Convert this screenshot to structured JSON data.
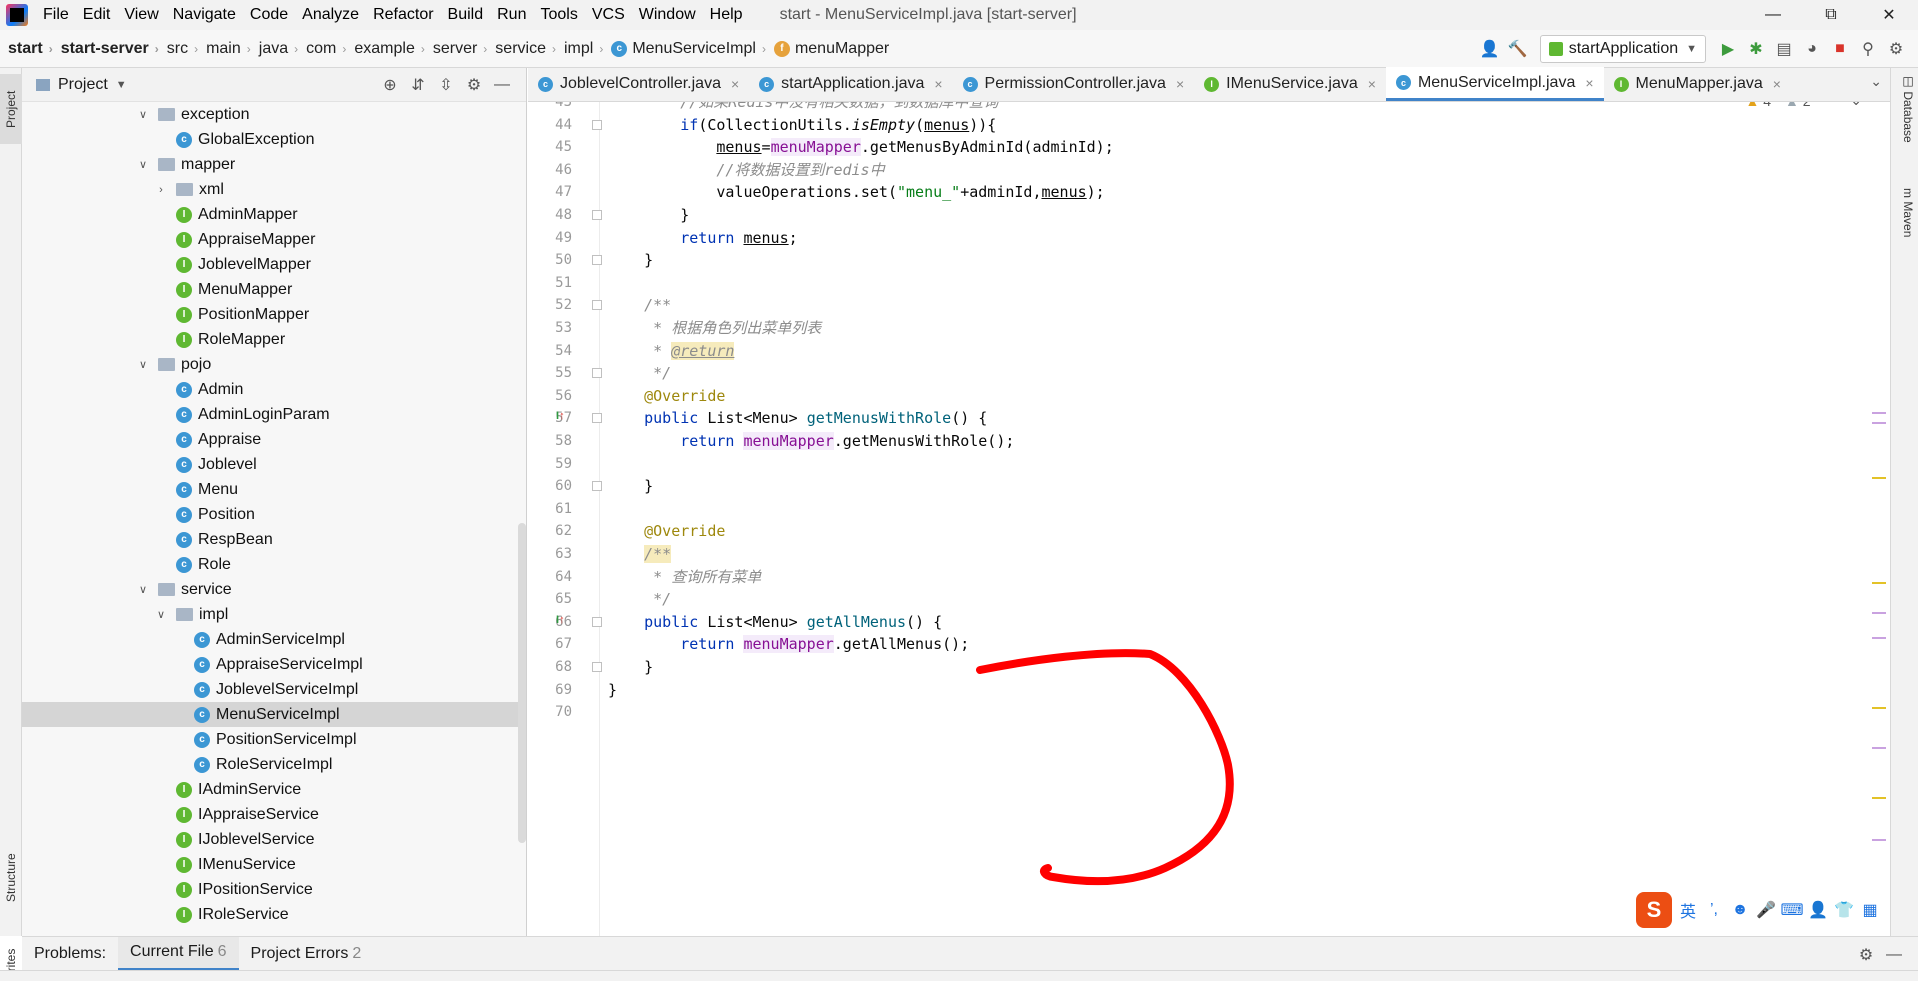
{
  "menubar": {
    "items": [
      "File",
      "Edit",
      "View",
      "Navigate",
      "Code",
      "Analyze",
      "Refactor",
      "Build",
      "Run",
      "Tools",
      "VCS",
      "Window",
      "Help"
    ],
    "title": "start - MenuServiceImpl.java [start-server]"
  },
  "breadcrumb": [
    "start",
    "start-server",
    "src",
    "main",
    "java",
    "com",
    "example",
    "server",
    "service",
    "impl",
    "MenuServiceImpl",
    "menuMapper"
  ],
  "toolbar": {
    "run_config": "startApplication"
  },
  "left_tabs": {
    "project": "Project",
    "structure": "Structure",
    "favorites": "Favorites"
  },
  "right_tabs": {
    "database": "Database",
    "maven": "Maven"
  },
  "project_panel": {
    "title": "Project",
    "tree": [
      {
        "label": "exception",
        "kind": "folder",
        "depth": 0,
        "expanded": true
      },
      {
        "label": "GlobalException",
        "kind": "class",
        "depth": 1
      },
      {
        "label": "mapper",
        "kind": "folder",
        "depth": 0,
        "expanded": true
      },
      {
        "label": "xml",
        "kind": "folder",
        "depth": 1,
        "expanded": false
      },
      {
        "label": "AdminMapper",
        "kind": "interface",
        "depth": 1
      },
      {
        "label": "AppraiseMapper",
        "kind": "interface",
        "depth": 1
      },
      {
        "label": "JoblevelMapper",
        "kind": "interface",
        "depth": 1
      },
      {
        "label": "MenuMapper",
        "kind": "interface",
        "depth": 1
      },
      {
        "label": "PositionMapper",
        "kind": "interface",
        "depth": 1
      },
      {
        "label": "RoleMapper",
        "kind": "interface",
        "depth": 1
      },
      {
        "label": "pojo",
        "kind": "folder",
        "depth": 0,
        "expanded": true
      },
      {
        "label": "Admin",
        "kind": "class",
        "depth": 1
      },
      {
        "label": "AdminLoginParam",
        "kind": "class",
        "depth": 1
      },
      {
        "label": "Appraise",
        "kind": "class",
        "depth": 1
      },
      {
        "label": "Joblevel",
        "kind": "class",
        "depth": 1
      },
      {
        "label": "Menu",
        "kind": "class",
        "depth": 1
      },
      {
        "label": "Position",
        "kind": "class",
        "depth": 1
      },
      {
        "label": "RespBean",
        "kind": "class",
        "depth": 1
      },
      {
        "label": "Role",
        "kind": "class",
        "depth": 1
      },
      {
        "label": "service",
        "kind": "folder",
        "depth": 0,
        "expanded": true
      },
      {
        "label": "impl",
        "kind": "folder",
        "depth": 1,
        "expanded": true
      },
      {
        "label": "AdminServiceImpl",
        "kind": "class",
        "depth": 2
      },
      {
        "label": "AppraiseServiceImpl",
        "kind": "class",
        "depth": 2
      },
      {
        "label": "JoblevelServiceImpl",
        "kind": "class",
        "depth": 2
      },
      {
        "label": "MenuServiceImpl",
        "kind": "class",
        "depth": 2,
        "selected": true
      },
      {
        "label": "PositionServiceImpl",
        "kind": "class",
        "depth": 2
      },
      {
        "label": "RoleServiceImpl",
        "kind": "class",
        "depth": 2
      },
      {
        "label": "IAdminService",
        "kind": "interface",
        "depth": 1
      },
      {
        "label": "IAppraiseService",
        "kind": "interface",
        "depth": 1
      },
      {
        "label": "IJoblevelService",
        "kind": "interface",
        "depth": 1
      },
      {
        "label": "IMenuService",
        "kind": "interface",
        "depth": 1
      },
      {
        "label": "IPositionService",
        "kind": "interface",
        "depth": 1
      },
      {
        "label": "IRoleService",
        "kind": "interface",
        "depth": 1
      }
    ]
  },
  "tabs": [
    {
      "label": "JoblevelController.java",
      "kind": "class"
    },
    {
      "label": "startApplication.java",
      "kind": "class"
    },
    {
      "label": "PermissionController.java",
      "kind": "class"
    },
    {
      "label": "IMenuService.java",
      "kind": "interface"
    },
    {
      "label": "MenuServiceImpl.java",
      "kind": "class",
      "active": true
    },
    {
      "label": "MenuMapper.java",
      "kind": "interface"
    }
  ],
  "inspections": {
    "warnings": "4",
    "weak_warnings": "2"
  },
  "code": {
    "lines": [
      {
        "n": "43",
        "html": "        <span class='cm'>//如果Redis中没有相关数据，到数据库中查询</span>"
      },
      {
        "n": "44",
        "html": "        <span class='kw'>if</span>(CollectionUtils.<i>isEmpty</i>(<span class='ul'>menus</span>)){"
      },
      {
        "n": "45",
        "html": "            <span class='ul'>menus</span>=<span class='fld'>menuMapper</span>.getMenusByAdminId(adminId);"
      },
      {
        "n": "46",
        "html": "            <span class='cm'>//将数据设置到redis中</span>"
      },
      {
        "n": "47",
        "html": "            valueOperations.set(<span class='st'>\"menu_\"</span>+adminId,<span class='ul'>menus</span>);"
      },
      {
        "n": "48",
        "html": "        }"
      },
      {
        "n": "49",
        "html": "        <span class='kw'>return</span> <span class='ul'>menus</span>;"
      },
      {
        "n": "50",
        "html": "    }"
      },
      {
        "n": "51",
        "html": ""
      },
      {
        "n": "52",
        "html": "    <span class='cm'>/**</span>"
      },
      {
        "n": "53",
        "html": "     <span class='cm'>* 根据角色列出菜单列表</span>"
      },
      {
        "n": "54",
        "html": "     <span class='cm'>* </span><span class='tag-return'>@return</span>"
      },
      {
        "n": "55",
        "html": "     <span class='cm'>*/</span>"
      },
      {
        "n": "56",
        "html": "    <span class='an'>@Override</span>"
      },
      {
        "n": "57",
        "html": "    <span class='kw'>public</span> List&lt;Menu&gt; <span class='fn'>getMenusWithRole</span>() {"
      },
      {
        "n": "58",
        "html": "        <span class='kw'>return</span> <span class='fld'>menuMapper</span>.getMenusWithRole();"
      },
      {
        "n": "59",
        "html": ""
      },
      {
        "n": "60",
        "html": "    }"
      },
      {
        "n": "61",
        "html": ""
      },
      {
        "n": "62",
        "html": "    <span class='an'>@Override</span>"
      },
      {
        "n": "63",
        "html": "    <span class='cm docstart'>/**</span>"
      },
      {
        "n": "64",
        "html": "     <span class='cm'>* 查询所有菜单</span>"
      },
      {
        "n": "65",
        "html": "     <span class='cm'>*/</span>"
      },
      {
        "n": "66",
        "html": "    <span class='kw'>public</span> List&lt;Menu&gt; <span class='fn'>getAllMenus</span>() {"
      },
      {
        "n": "67",
        "html": "        <span class='kw'>return</span> <span class='fld'>menuMapper</span>.getAllMenus();"
      },
      {
        "n": "68",
        "html": "    }"
      },
      {
        "n": "69",
        "html": "}"
      },
      {
        "n": "70",
        "html": ""
      }
    ],
    "fold_lines": [
      "44",
      "48",
      "50",
      "52",
      "55",
      "57",
      "60",
      "66",
      "68"
    ],
    "impl_marker_lines": [
      "57",
      "66"
    ]
  },
  "ime": {
    "lang": "英",
    "logo": "S"
  },
  "problems": {
    "label": "Problems:",
    "tabs": [
      {
        "label": "Current File",
        "count": "6",
        "active": true
      },
      {
        "label": "Project Errors",
        "count": "2"
      }
    ]
  },
  "colors": {
    "accent": "#4083c9",
    "annotation": "#ff0000",
    "class_icon": "#3c97d4",
    "interface_icon": "#5fb832"
  }
}
